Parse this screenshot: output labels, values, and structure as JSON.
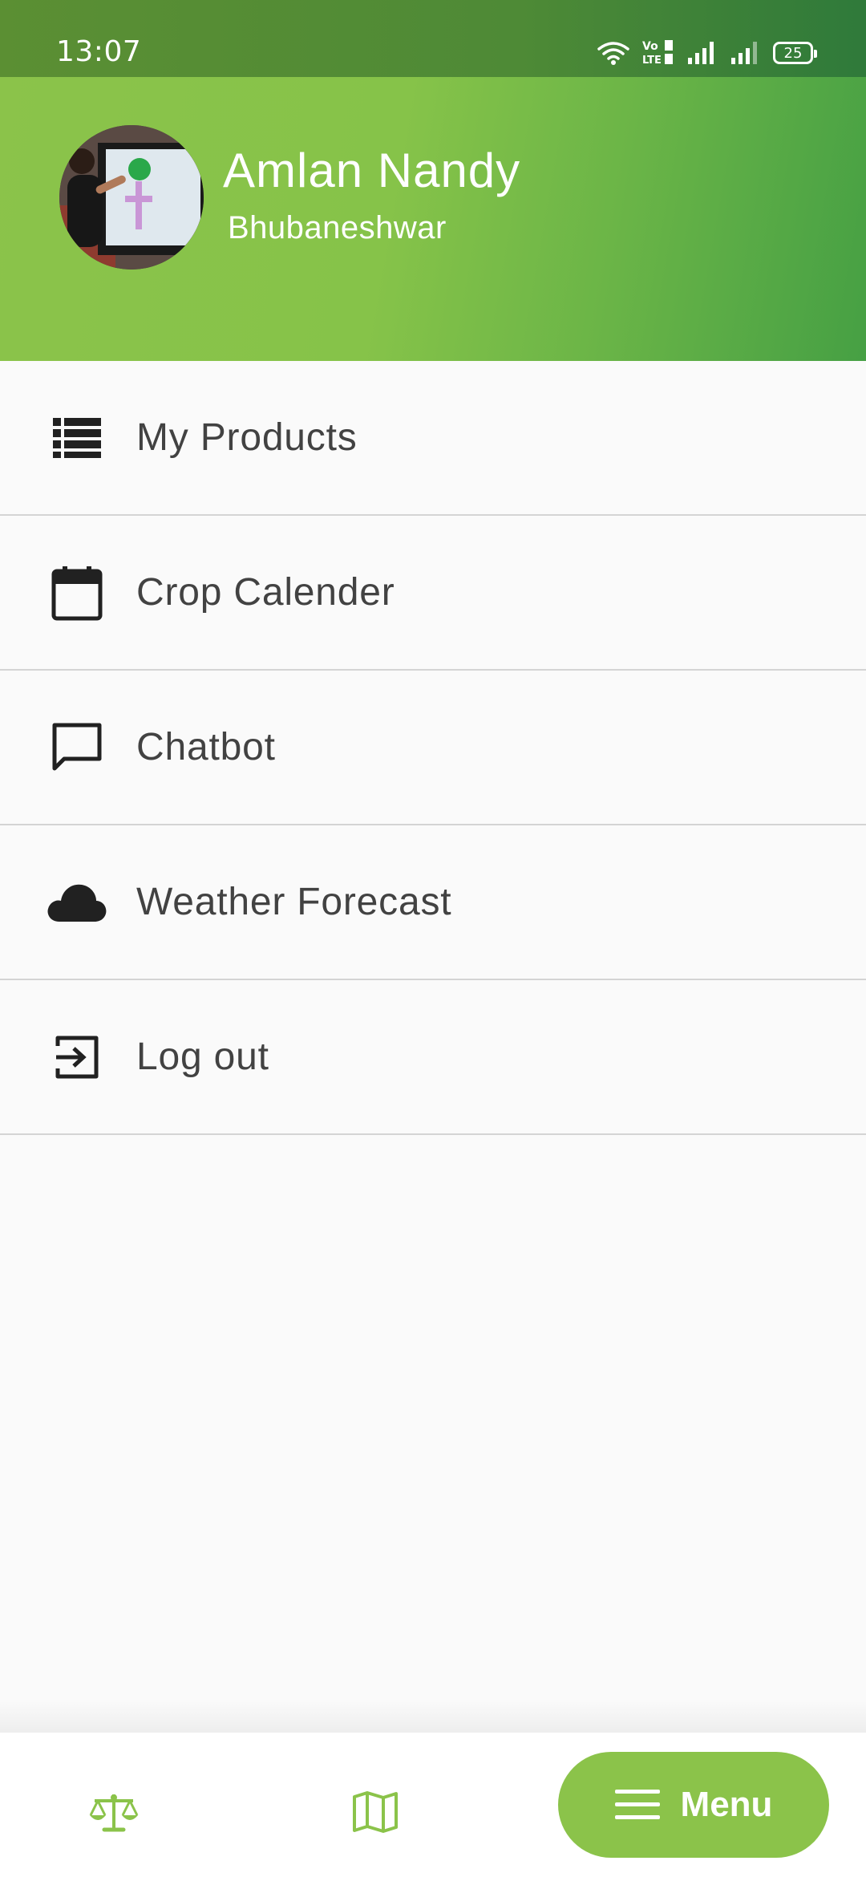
{
  "status_bar": {
    "time": "13:07",
    "network_label": "Vo LTE",
    "battery": "25"
  },
  "profile": {
    "name": "Amlan Nandy",
    "location": "Bhubaneshwar"
  },
  "menu": {
    "items": [
      {
        "label": "My Products",
        "icon": "list-icon"
      },
      {
        "label": "Crop Calender",
        "icon": "calendar-icon"
      },
      {
        "label": "Chatbot",
        "icon": "chat-icon"
      },
      {
        "label": "Weather Forecast",
        "icon": "cloud-icon"
      },
      {
        "label": "Log out",
        "icon": "logout-icon"
      }
    ]
  },
  "bottom_nav": {
    "menu_label": "Menu",
    "items": [
      {
        "icon": "scale-icon"
      },
      {
        "icon": "map-icon"
      },
      {
        "icon": "hamburger-icon"
      }
    ]
  },
  "colors": {
    "accent": "#8bc34a",
    "header_dark": "#46a044",
    "text": "#424242",
    "divider": "#d4d4d4"
  }
}
